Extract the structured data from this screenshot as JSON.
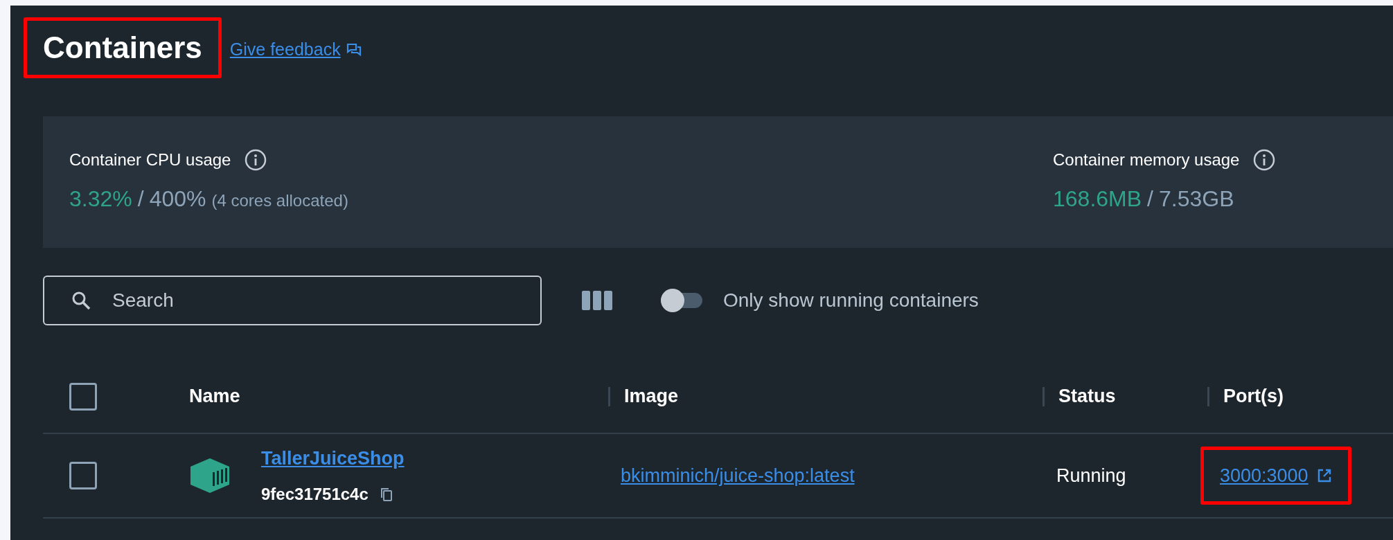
{
  "header": {
    "title": "Containers",
    "title_highlighted": true,
    "feedback_link": "Give feedback"
  },
  "stats": [
    {
      "label": "Container CPU usage",
      "used": "3.32%",
      "separator": "/",
      "total": "400%",
      "note": "(4 cores allocated)"
    },
    {
      "label": "Container memory usage",
      "used": "168.6MB",
      "separator": "/",
      "total": "7.53GB"
    }
  ],
  "toolbar": {
    "search": {
      "placeholder": "Search"
    },
    "running_only": {
      "label": "Only show running containers",
      "on": false
    }
  },
  "table": {
    "select_all": {
      "checked": false
    },
    "columns": [
      "Name",
      "Image",
      "Status",
      "Port(s)"
    ],
    "rows": [
      {
        "checked": false,
        "name": "TallerJuiceShop",
        "id": "9fec31751c4c",
        "image": "bkimminich/juice-shop:latest",
        "status": "Running",
        "ports": "3000:3000",
        "ports_highlighted": true
      }
    ]
  }
}
